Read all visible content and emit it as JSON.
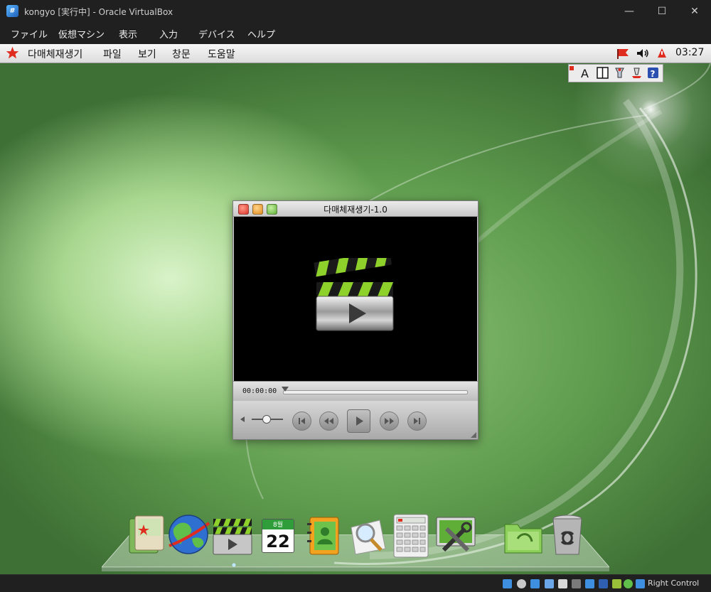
{
  "host": {
    "title": "kongyo [実行中] - Oracle VirtualBox",
    "app_icon_glyph": "#",
    "window_controls": {
      "minimize": "—",
      "maximize": "☐",
      "close": "✕"
    },
    "menu": [
      "ファイル",
      "仮想マシン",
      "表示",
      "入力",
      "デバイス",
      "ヘルプ"
    ],
    "status_host_key": "Right Control",
    "status_icons": [
      "hard-disk-icon",
      "optical-drive-icon",
      "audio-icon",
      "network-icon",
      "usb-icon",
      "shared-folder-icon",
      "display-icon",
      "screen-recording-icon",
      "cpu-icon",
      "mouse-integration-icon",
      "arrow-down-icon"
    ]
  },
  "guest": {
    "panel": {
      "app_name": "다매체재생기",
      "menu": [
        "파일",
        "보기",
        "창문",
        "도움말"
      ],
      "clock": "03:27",
      "tray": [
        "flag-icon",
        "volume-icon",
        "notification-icon"
      ]
    },
    "ime": {
      "buttons": [
        "input-mode-icon",
        "full-half-width-icon",
        "tools-icon",
        "help-icon"
      ],
      "mode_glyph": "A"
    },
    "player": {
      "title": "다매체재생기-1.0",
      "time": "00:00:00",
      "position_fraction": 0,
      "volume_fraction": 0.45
    },
    "dock": {
      "items": [
        "photos-icon",
        "web-browser-icon",
        "media-player-icon",
        "calendar-icon",
        "contacts-icon",
        "search-icon",
        "calculator-icon",
        "system-settings-icon",
        "file-manager-icon",
        "trash-icon"
      ],
      "calendar_month": "8월",
      "calendar_day": "22"
    }
  },
  "colors": {
    "host_chrome": "#202020",
    "guest_panel": "#e8e8e8",
    "accent_green": "#8fd12b",
    "star_red": "#e02b1f"
  }
}
